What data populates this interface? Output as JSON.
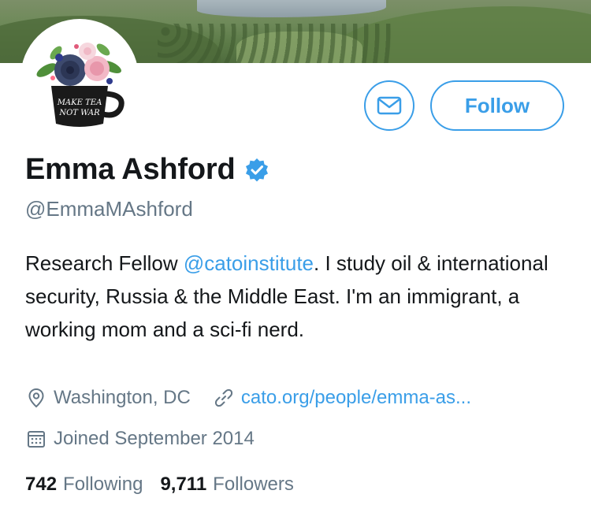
{
  "profile": {
    "avatar_text_line1": "MAKE TEA",
    "avatar_text_line2": "NOT WAR",
    "name": "Emma Ashford",
    "handle": "@EmmaMAshford",
    "verified": true,
    "bio_before_mention": "Research Fellow ",
    "bio_mention": "@catoinstitute",
    "bio_after_mention": ". I study oil & international security, Russia & the Middle East. I'm an immigrant, a working mom and a sci-fi nerd.",
    "location": "Washington, DC",
    "website": "cato.org/people/emma-as...",
    "joined": "Joined September 2014",
    "following_count": "742",
    "following_label": "Following",
    "followers_count": "9,711",
    "followers_label": "Followers"
  },
  "actions": {
    "message_icon": "envelope-icon",
    "follow_label": "Follow"
  },
  "icons": {
    "verified": "verified-badge-icon",
    "location": "location-pin-icon",
    "website": "link-icon",
    "joined": "calendar-icon"
  },
  "colors": {
    "accent": "#3a9ee8",
    "text": "#14171a",
    "secondary": "#657786"
  }
}
